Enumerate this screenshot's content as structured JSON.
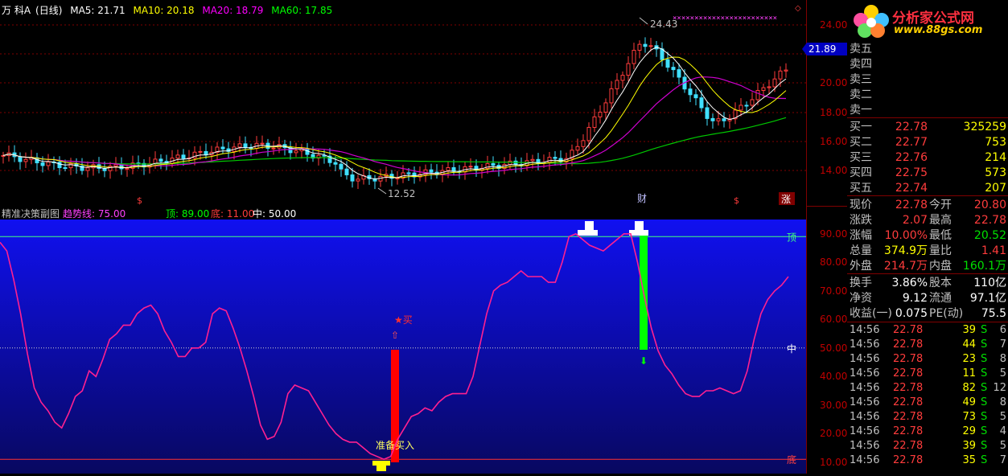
{
  "header": {
    "stock": "万 科A",
    "period": "(日线)",
    "ma": [
      {
        "label": "MA5: 21.71",
        "color": "#ffffff"
      },
      {
        "label": "MA10: 20.18",
        "color": "#ffff00"
      },
      {
        "label": "MA20: 18.79",
        "color": "#ff00ff"
      },
      {
        "label": "MA60: 17.85",
        "color": "#00ff00"
      }
    ]
  },
  "main_chart": {
    "price_high_label": "24.43",
    "price_low_label": "12.52",
    "current_price_tag": "21.89",
    "axis_ticks": [
      "24.00",
      "22.00",
      "20.00",
      "18.00",
      "16.00",
      "14.00"
    ],
    "markers": [
      {
        "text": "$",
        "color": "#ff3c3c"
      },
      {
        "text": "财",
        "color": "#c0c0ff"
      },
      {
        "text": "$",
        "color": "#ff3c3c"
      },
      {
        "text": "涨",
        "color": "#ffffff"
      }
    ]
  },
  "sub_chart": {
    "title": "精准决策副图",
    "trend_label": "趋势线: 75.00",
    "top_label": "顶: 89.00",
    "bottom_label": "底: 11.00",
    "mid_label": "中: 50.00",
    "axis_ticks": [
      "90.00",
      "80.00",
      "70.00",
      "60.00",
      "50.00",
      "40.00",
      "30.00",
      "20.00",
      "10.00"
    ],
    "line_top": "顶",
    "line_mid": "中",
    "line_bottom": "底",
    "buy_label": "★买",
    "prepare_buy": "准备买入",
    "trend_values": [
      87,
      84,
      74,
      62,
      48,
      36,
      31,
      28,
      24,
      22,
      27,
      33,
      35,
      42,
      40,
      46,
      53,
      55,
      58,
      58,
      62,
      64,
      65,
      62,
      56,
      52,
      47,
      47,
      50,
      50,
      52,
      62,
      64,
      63,
      57,
      50,
      42,
      33,
      23,
      18,
      19,
      24,
      34,
      37,
      36,
      35,
      31,
      27,
      23,
      20,
      18,
      17,
      17,
      15,
      13,
      12,
      11,
      12,
      18,
      22,
      26,
      27,
      29,
      28,
      31,
      33,
      34,
      34,
      34,
      40,
      51,
      62,
      70,
      72,
      73,
      75,
      77,
      75,
      75,
      75,
      73,
      73,
      80,
      89,
      90,
      88,
      86,
      85,
      84,
      86,
      88,
      90,
      90,
      80,
      68,
      57,
      49,
      44,
      41,
      37,
      34,
      33,
      33,
      35,
      35,
      36,
      35,
      34,
      35,
      42,
      53,
      62,
      67,
      70,
      72,
      75
    ],
    "ylim": [
      6,
      95
    ]
  },
  "quote_panel": {
    "logo_text": "分析家公式网",
    "logo_url": "www.88gs.com",
    "asks": [
      {
        "label": "卖五",
        "price": "",
        "vol": ""
      },
      {
        "label": "卖四",
        "price": "",
        "vol": ""
      },
      {
        "label": "卖三",
        "price": "",
        "vol": ""
      },
      {
        "label": "卖二",
        "price": "",
        "vol": ""
      },
      {
        "label": "卖一",
        "price": "",
        "vol": ""
      }
    ],
    "bids": [
      {
        "label": "买一",
        "price": "22.78",
        "vol": "325259"
      },
      {
        "label": "买二",
        "price": "22.77",
        "vol": "753"
      },
      {
        "label": "买三",
        "price": "22.76",
        "vol": "214"
      },
      {
        "label": "买四",
        "price": "22.75",
        "vol": "573"
      },
      {
        "label": "买五",
        "price": "22.74",
        "vol": "207"
      }
    ],
    "stats": [
      {
        "l1": "现价",
        "v1": "22.78",
        "c1": "#ff3c3c",
        "l2": "今开",
        "v2": "20.80",
        "c2": "#ff3c3c"
      },
      {
        "l1": "涨跌",
        "v1": "2.07",
        "c1": "#ff3c3c",
        "l2": "最高",
        "v2": "22.78",
        "c2": "#ff3c3c"
      },
      {
        "l1": "涨幅",
        "v1": "10.00%",
        "c1": "#ff3c3c",
        "l2": "最低",
        "v2": "20.52",
        "c2": "#00e000"
      },
      {
        "l1": "总量",
        "v1": "374.9万",
        "c1": "#ffff00",
        "l2": "量比",
        "v2": "1.41",
        "c2": "#ff3c3c"
      },
      {
        "l1": "外盘",
        "v1": "214.7万",
        "c1": "#ff3c3c",
        "l2": "内盘",
        "v2": "160.1万",
        "c2": "#00e000"
      }
    ],
    "stats2": [
      {
        "l1": "换手",
        "v1": "3.86%",
        "l2": "股本",
        "v2": "110亿"
      },
      {
        "l1": "净资",
        "v1": "9.12",
        "l2": "流通",
        "v2": "97.1亿"
      },
      {
        "l1": "收益(一)",
        "v1": "0.075",
        "l2": "PE(动)",
        "v2": "75.5"
      }
    ],
    "ticks": [
      {
        "time": "14:56",
        "price": "22.78",
        "vol": "39",
        "side": "S",
        "n": "6"
      },
      {
        "time": "14:56",
        "price": "22.78",
        "vol": "44",
        "side": "S",
        "n": "7"
      },
      {
        "time": "14:56",
        "price": "22.78",
        "vol": "23",
        "side": "S",
        "n": "8"
      },
      {
        "time": "14:56",
        "price": "22.78",
        "vol": "11",
        "side": "S",
        "n": "5"
      },
      {
        "time": "14:56",
        "price": "22.78",
        "vol": "82",
        "side": "S",
        "n": "12"
      },
      {
        "time": "14:56",
        "price": "22.78",
        "vol": "49",
        "side": "S",
        "n": "8"
      },
      {
        "time": "14:56",
        "price": "22.78",
        "vol": "73",
        "side": "S",
        "n": "5"
      },
      {
        "time": "14:56",
        "price": "22.78",
        "vol": "29",
        "side": "S",
        "n": "4"
      },
      {
        "time": "14:56",
        "price": "22.78",
        "vol": "39",
        "side": "S",
        "n": "5"
      },
      {
        "time": "14:56",
        "price": "22.78",
        "vol": "35",
        "side": "S",
        "n": "7"
      }
    ]
  }
}
